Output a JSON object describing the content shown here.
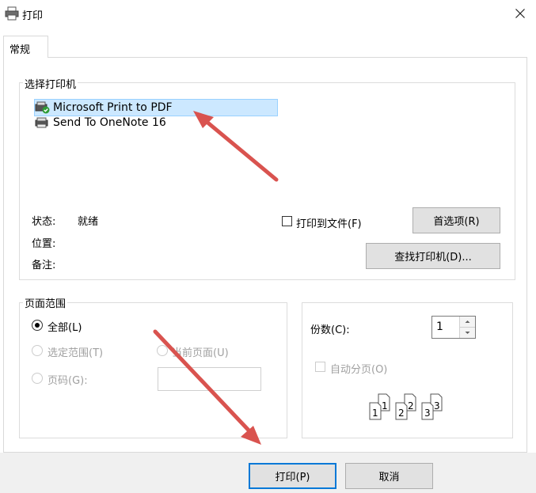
{
  "window": {
    "title": "打印",
    "close_icon": "close-icon"
  },
  "tab": {
    "label": "常规"
  },
  "select_printer": {
    "group_label": "选择打印机",
    "printers": [
      {
        "name": "Microsoft Print to PDF",
        "selected": true,
        "icon": "printer-default-icon"
      },
      {
        "name": "Send To OneNote 16",
        "selected": false,
        "icon": "printer-icon"
      }
    ],
    "status_label": "状态:",
    "status_value": "就绪",
    "location_label": "位置:",
    "comment_label": "备注:",
    "print_to_file_label": "打印到文件(F)",
    "preferences_button": "首选项(R)",
    "find_printer_button": "查找打印机(D)..."
  },
  "page_range": {
    "group_label": "页面范围",
    "all_label": "全部(L)",
    "selection_label": "选定范围(T)",
    "current_page_label": "当前页面(U)",
    "pages_label": "页码(G):",
    "pages_value": ""
  },
  "copies": {
    "label": "份数(C):",
    "value": "1",
    "collate_label": "自动分页(O)",
    "collate_pages": [
      "1",
      "1",
      "2",
      "2",
      "3",
      "3"
    ]
  },
  "footer": {
    "print_button": "打印(P)",
    "cancel_button": "取消"
  },
  "colors": {
    "selection_bg": "#cce8ff",
    "accent": "#0078d7",
    "annotation_arrow": "#d9534f"
  }
}
